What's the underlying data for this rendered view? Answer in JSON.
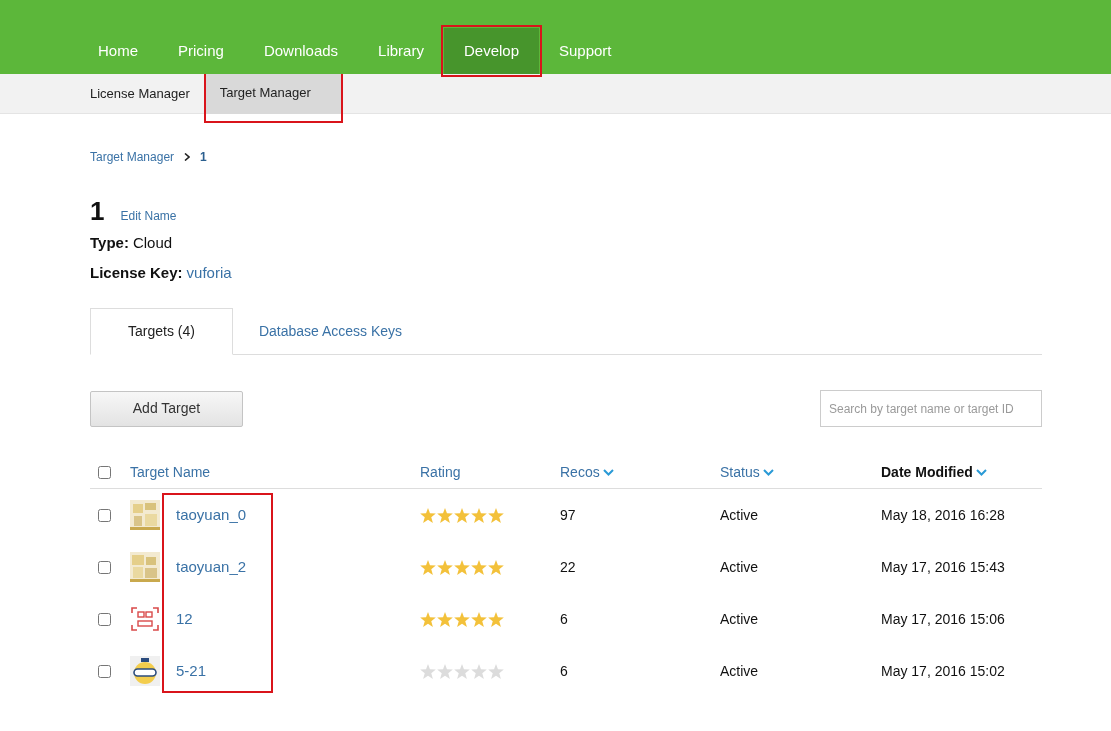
{
  "nav": [
    {
      "label": "Home",
      "selected": false,
      "annotated": false
    },
    {
      "label": "Pricing",
      "selected": false,
      "annotated": false
    },
    {
      "label": "Downloads",
      "selected": false,
      "annotated": false
    },
    {
      "label": "Library",
      "selected": false,
      "annotated": false
    },
    {
      "label": "Develop",
      "selected": true,
      "annotated": true
    },
    {
      "label": "Support",
      "selected": false,
      "annotated": false
    }
  ],
  "subnav": [
    {
      "label": "License Manager",
      "selected": false,
      "annotated": false
    },
    {
      "label": "Target Manager",
      "selected": true,
      "annotated": true
    }
  ],
  "breadcrumb": [
    {
      "label": "Target Manager",
      "kind": "link"
    },
    {
      "label": "1",
      "kind": "current"
    }
  ],
  "database": {
    "name": "1",
    "edit_link": "Edit Name",
    "fields": [
      {
        "label": "Type:",
        "value": "Cloud",
        "kind": "text"
      },
      {
        "label": "License Key:",
        "value": "vuforia",
        "kind": "link"
      }
    ]
  },
  "tabs": [
    {
      "label": "Targets (4)",
      "selected": true
    },
    {
      "label": "Database Access Keys",
      "selected": false
    }
  ],
  "add_button": "Add Target",
  "search": {
    "placeholder": "Search by target name or target ID"
  },
  "table": {
    "select_all": false,
    "name_column_annotated": true,
    "columns": [
      {
        "label": "Target Name",
        "sortable": false,
        "sorted": false
      },
      {
        "label": "Rating",
        "sortable": false,
        "sorted": false
      },
      {
        "label": "Recos",
        "sortable": true,
        "sorted": false
      },
      {
        "label": "Status",
        "sortable": true,
        "sorted": false
      },
      {
        "label": "Date Modified",
        "sortable": true,
        "sorted": true
      }
    ],
    "rows": [
      {
        "checked": false,
        "name": "taoyuan_0",
        "stars": 5,
        "recos": "97",
        "status": "Active",
        "date": "May 18, 2016 16:28"
      },
      {
        "checked": false,
        "name": "taoyuan_2",
        "stars": 5,
        "recos": "22",
        "status": "Active",
        "date": "May 17, 2016 15:43"
      },
      {
        "checked": false,
        "name": "12",
        "stars": 5,
        "recos": "6",
        "status": "Active",
        "date": "May 17, 2016 15:06"
      },
      {
        "checked": false,
        "name": "5-21",
        "stars": 0,
        "recos": "6",
        "status": "Active",
        "date": "May 17, 2016 15:02"
      }
    ]
  }
}
